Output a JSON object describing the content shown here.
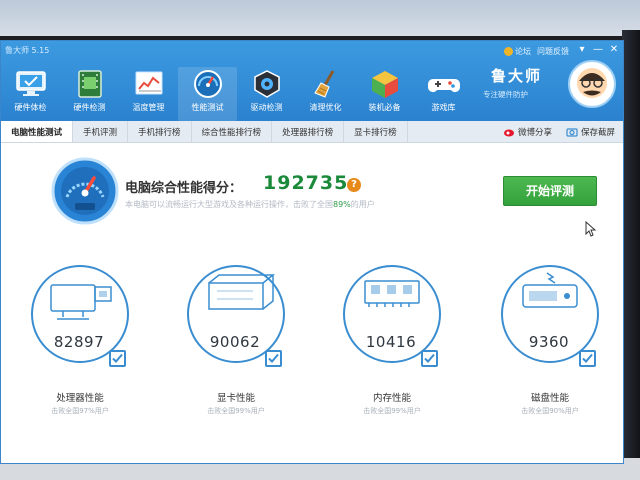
{
  "window": {
    "title": "鲁大师 5.15",
    "links": [
      "论坛",
      "问题反馈"
    ],
    "controls": [
      "▾",
      "—",
      "✕"
    ]
  },
  "toolbar": {
    "items": [
      {
        "label": "硬件体检",
        "icon": "monitor-check-icon"
      },
      {
        "label": "硬件检测",
        "icon": "chip-icon"
      },
      {
        "label": "温度管理",
        "icon": "temperature-chart-icon"
      },
      {
        "label": "性能测试",
        "icon": "speedometer-icon",
        "active": true
      },
      {
        "label": "驱动检测",
        "icon": "driver-gear-icon"
      },
      {
        "label": "清理优化",
        "icon": "broom-icon"
      },
      {
        "label": "装机必备",
        "icon": "cube-icon"
      },
      {
        "label": "游戏库",
        "icon": "gamepad-icon"
      }
    ]
  },
  "brand": {
    "name": "鲁大师",
    "slogan": "专注硬件防护"
  },
  "tabs": {
    "items": [
      "电脑性能测试",
      "手机评测",
      "手机排行榜",
      "综合性能排行榜",
      "处理器排行榜",
      "显卡排行榜"
    ],
    "active_index": 0,
    "actions": [
      "微博分享",
      "保存截屏"
    ]
  },
  "score": {
    "title": "电脑综合性能得分：",
    "value": "192735",
    "help": "?",
    "desc_prefix": "本电脑可以流畅运行大型游戏及各种运行操作，击败了全国",
    "desc_percent": "89%",
    "desc_suffix": "的用户"
  },
  "start_button": "开始评测",
  "cards": [
    {
      "name": "processor",
      "score": "82897",
      "title": "处理器性能",
      "desc": "击败全国97%用户",
      "checked": true
    },
    {
      "name": "graphics",
      "score": "90062",
      "title": "显卡性能",
      "desc": "击败全国99%用户",
      "checked": true
    },
    {
      "name": "memory",
      "score": "10416",
      "title": "内存性能",
      "desc": "击败全国99%用户",
      "checked": true
    },
    {
      "name": "disk",
      "score": "9360",
      "title": "磁盘性能",
      "desc": "击败全国90%用户",
      "checked": true
    }
  ],
  "colors": {
    "header": "#2b82cf",
    "accent": "#3a8dd0",
    "score": "#1a8a3a",
    "start_button": "#34a23c",
    "help": "#e88a1a"
  }
}
